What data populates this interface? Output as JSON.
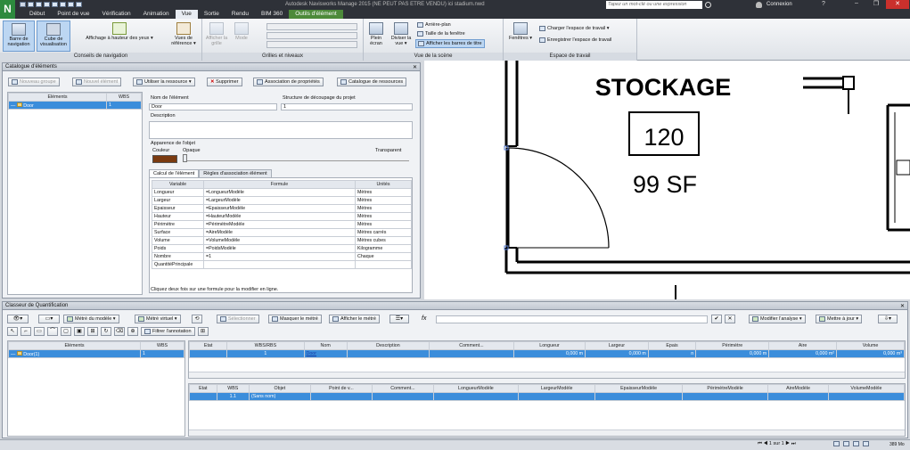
{
  "titlebar": {
    "title": "Autodesk Navisworks Manage 2015 (NE PEUT PAS ETRE VENDU)   ici stadium.nwd",
    "search_placeholder": "Tapez un mot-clé ou une expression",
    "user": "Connexion"
  },
  "menu": [
    "Début",
    "Point de vue",
    "Vérification",
    "Animation",
    "Vue",
    "Sortie",
    "Rendu",
    "BIM 360",
    "Outils d'élément"
  ],
  "ribbon": {
    "nav": {
      "bar": "Barre de navigation",
      "cube": "Cube de visualisation",
      "label": "Conseils de navigation"
    },
    "hud": "Affichage à hauteur des yeux",
    "ref": "Vues de référence",
    "grid": {
      "show": "Afficher la grille",
      "mode": "Mode",
      "label": "Grilles et niveaux"
    },
    "scene": {
      "full": "Plein écran",
      "split": "Diviser la vue",
      "bg": "Arrière-plan",
      "size": "Taille de la fenêtre",
      "tb": "Afficher les barres de titre",
      "label": "Vue de la scène"
    },
    "ws": {
      "windows": "Fenêtres",
      "load": "Charger l'espace de travail",
      "save": "Enregistrer l'espace de travail",
      "label": "Espace de travail"
    }
  },
  "catalog": {
    "title": "Catalogue d'éléments",
    "buttons": {
      "new_group": "Nouveau groupe",
      "new_item": "Nouvel élément",
      "use": "Utiliser la ressource",
      "delete": "Supprimer",
      "assoc": "Association de propriétés",
      "res_cat": "Catalogue de ressources"
    },
    "tree_headers": [
      "Eléments",
      "WBS"
    ],
    "tree_row": {
      "name": "Door",
      "wbs": "1"
    },
    "fields": {
      "name_label": "Nom de l'élément",
      "name_value": "Door",
      "wbs_label": "Structure de découpage du projet",
      "wbs_value": "1",
      "desc_label": "Description",
      "appearance": "Apparence de l'objet",
      "color": "Couleur",
      "opacity": "Opaque",
      "transparent": "Transparent"
    },
    "color_value": "#7a3a10",
    "tabs": [
      "Calcul de l'élément",
      "Règles d'association élément"
    ],
    "calc_headers": [
      "Variable",
      "Formule",
      "Unités"
    ],
    "calc_rows": [
      [
        "Longueur",
        "=LongueurModèle",
        "Mètres"
      ],
      [
        "Largeur",
        "=LargeurModèle",
        "Mètres"
      ],
      [
        "Epaisseur",
        "=EpaisseurModèle",
        "Mètres"
      ],
      [
        "Hauteur",
        "=HauteurModèle",
        "Mètres"
      ],
      [
        "Périmètre",
        "=PérimètreModèle",
        "Mètres"
      ],
      [
        "Surface",
        "=AireModèle",
        "Mètres carrés"
      ],
      [
        "Volume",
        "=VolumeModèle",
        "Mètres cubes"
      ],
      [
        "Poids",
        "=PoidsModèle",
        "Kilogramme"
      ],
      [
        "Nombre",
        "=1",
        "Chaque"
      ],
      [
        "QuantitéPrincipale",
        "",
        ""
      ]
    ],
    "hint": "Cliquez deux fois sur une formule pour la modifier en ligne."
  },
  "drawing": {
    "room_name": "STOCKAGE",
    "room_number": "120",
    "room_area": "99 SF"
  },
  "quant": {
    "title": "Classeur de Quantification",
    "buttons": {
      "model": "Métré du modèle",
      "virtual": "Métré virtuel",
      "select": "Sélectionner",
      "hide": "Masquer le métré",
      "show": "Afficher le métré",
      "filter": "Filtrer l'annotation",
      "analyse": "Modifier l'analyse",
      "update": "Mettre à jour",
      "fx": "fx"
    },
    "tree_headers": [
      "Eléments",
      "WBS"
    ],
    "tree_row": {
      "name": "Door(1)",
      "wbs": "1"
    },
    "top_headers": [
      "Etat",
      "WBS/RBS",
      "Nom",
      "Description",
      "Comment...",
      "Longueur",
      "Largeur",
      "Epais",
      "Périmètre",
      "Aire",
      "Volume"
    ],
    "top_row": [
      "",
      "1",
      "Door",
      "",
      "",
      "0,000 m",
      "0,000 m",
      "n",
      "0,000 m",
      "0,000 m²",
      "0,000 m³"
    ],
    "bottom_headers": [
      "Etat",
      "WBS",
      "Objet",
      "Point de v...",
      "Comment...",
      "LongueurModèle",
      "LargeurModèle",
      "EpaisseurModèle",
      "PérimètreModèle",
      "AireModèle",
      "VolumeModèle"
    ],
    "bottom_row": [
      "",
      "1.1",
      "(Sans nom)",
      "",
      "",
      "",
      "",
      "",
      "",
      "",
      ""
    ]
  },
  "status": {
    "page": "1 sur 1",
    "memory": "389 Mo"
  }
}
